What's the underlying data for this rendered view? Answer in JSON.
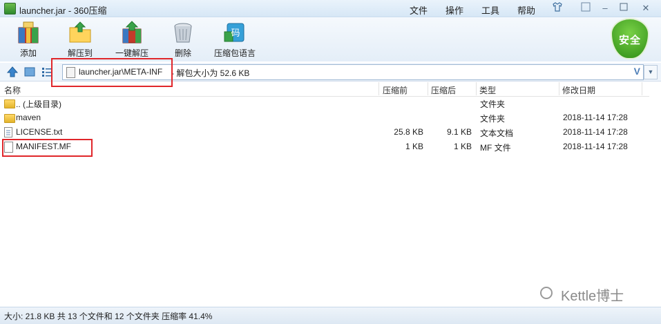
{
  "window": {
    "title": "launcher.jar - 360压缩"
  },
  "menu": [
    "文件",
    "操作",
    "工具",
    "帮助"
  ],
  "toolbar": {
    "add": "添加",
    "extract_to": "解压到",
    "one_click_extract": "一键解压",
    "delete": "删除",
    "code_page": "压缩包语言",
    "code_icon_char": "码"
  },
  "security": {
    "label": "安全"
  },
  "address": {
    "path": "launcher.jar\\META-INF",
    "info": "- 解包大小为 52.6 KB",
    "suggest": "V"
  },
  "columns": {
    "name": "名称",
    "compressed_before": "压缩前",
    "compressed_after": "压缩后",
    "type": "类型",
    "modified": "修改日期"
  },
  "files": [
    {
      "name": ".. (上级目录)",
      "before": "",
      "after": "",
      "type": "文件夹",
      "modified": "",
      "icon": "folder-icon"
    },
    {
      "name": "maven",
      "before": "",
      "after": "",
      "type": "文件夹",
      "modified": "2018-11-14 17:28",
      "icon": "folder-icon"
    },
    {
      "name": "LICENSE.txt",
      "before": "25.8 KB",
      "after": "9.1 KB",
      "type": "文本文档",
      "modified": "2018-11-14 17:28",
      "icon": "text-file-icon"
    },
    {
      "name": "MANIFEST.MF",
      "before": "1 KB",
      "after": "1 KB",
      "type": "MF 文件",
      "modified": "2018-11-14 17:28",
      "icon": "file-icon"
    }
  ],
  "status": {
    "text": "大小: 21.8 KB 共 13 个文件和 12 个文件夹 压缩率 41.4%"
  },
  "watermark": {
    "text": "Kettle博士"
  },
  "colors": {
    "highlight": "#e0262a",
    "accent": "#2f8e16"
  }
}
